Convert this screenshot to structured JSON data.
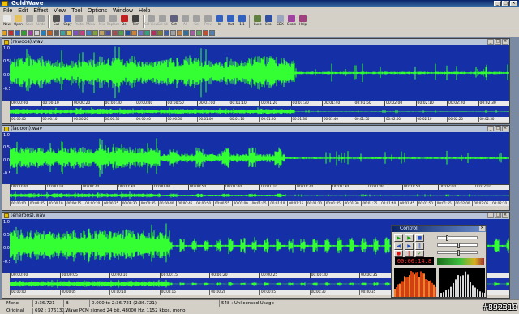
{
  "window": {
    "title": "GoldWave"
  },
  "menu": [
    "File",
    "Edit",
    "Effect",
    "View",
    "Tool",
    "Options",
    "Window",
    "Help"
  ],
  "toolbar": [
    {
      "label": "New",
      "icon": "new-doc-icon",
      "color": "#e8e8e8",
      "enabled": true
    },
    {
      "label": "Open",
      "icon": "open-folder-icon",
      "color": "#e5c060",
      "enabled": true
    },
    {
      "label": "Save",
      "icon": "save-icon",
      "color": "#a0a0a0",
      "enabled": false
    },
    {
      "label": "Undo",
      "icon": "undo-icon",
      "color": "#a0a0a0",
      "enabled": false
    },
    {
      "label": "Cut",
      "icon": "cut-icon",
      "color": "#505050",
      "enabled": true
    },
    {
      "label": "Copy",
      "icon": "copy-icon",
      "color": "#4060c0",
      "enabled": true
    },
    {
      "label": "Paste",
      "icon": "paste-icon",
      "color": "#a0a0a0",
      "enabled": false
    },
    {
      "label": "P.New",
      "icon": "paste-new-icon",
      "color": "#a0a0a0",
      "enabled": false
    },
    {
      "label": "Mix",
      "icon": "mix-icon",
      "color": "#a0a0a0",
      "enabled": false
    },
    {
      "label": "Replace",
      "icon": "replace-icon",
      "color": "#a0a0a0",
      "enabled": false
    },
    {
      "label": "Del",
      "icon": "delete-icon",
      "color": "#c02020",
      "enabled": true
    },
    {
      "label": "Trim",
      "icon": "trim-icon",
      "color": "#404040",
      "enabled": true
    },
    {
      "label": "Sel View",
      "icon": "select-view-icon",
      "color": "#a0a0a0",
      "enabled": false
    },
    {
      "label": "Sel All",
      "icon": "select-all-icon",
      "color": "#a0a0a0",
      "enabled": false
    },
    {
      "label": "Set",
      "icon": "set-icon",
      "color": "#606080",
      "enabled": true
    },
    {
      "label": "All",
      "icon": "all-icon",
      "color": "#a0a0a0",
      "enabled": false
    },
    {
      "label": "Sel",
      "icon": "sel-icon",
      "color": "#a0a0a0",
      "enabled": false
    },
    {
      "label": "Prev",
      "icon": "prev-icon",
      "color": "#a0a0a0",
      "enabled": false
    },
    {
      "label": "In",
      "icon": "zoom-in-icon",
      "color": "#3060c0",
      "enabled": true
    },
    {
      "label": "Out",
      "icon": "zoom-out-icon",
      "color": "#3060c0",
      "enabled": true
    },
    {
      "label": "1:1",
      "icon": "zoom-100-icon",
      "color": "#3060c0",
      "enabled": true
    },
    {
      "label": "Cues",
      "icon": "cues-icon",
      "color": "#608040",
      "enabled": true
    },
    {
      "label": "Eval",
      "icon": "eval-icon",
      "color": "#2f50a0",
      "enabled": true
    },
    {
      "label": "CDX",
      "icon": "cd-icon",
      "color": "#9aa6c0",
      "enabled": true
    },
    {
      "label": "Chain",
      "icon": "chain-icon",
      "color": "#a040a0",
      "enabled": true
    },
    {
      "label": "Help",
      "icon": "help-icon",
      "color": "#a04080",
      "enabled": true
    }
  ],
  "waves": [
    {
      "title": "(rewoos).wav",
      "scale": [
        "1.0",
        "0.5",
        "0.0",
        "-0.5"
      ],
      "ticks": [
        "00:00:00",
        "00:00:10",
        "00:00:20",
        "00:00:30",
        "00:00:40",
        "00:00:50",
        "00:01:00",
        "00:01:10",
        "00:01:20",
        "00:01:30",
        "00:01:40",
        "00:01:50",
        "00:02:00",
        "00:02:10",
        "00:02:20",
        "00:02:30"
      ],
      "overview_ticks": [
        "00:00:00",
        "00:00:10",
        "00:00:20",
        "00:00:30",
        "00:00:40",
        "00:00:50",
        "00:01:00",
        "00:01:10",
        "00:01:20",
        "00:01:30",
        "00:01:40",
        "00:01:50",
        "00:02:00",
        "00:02:10",
        "00:02:20",
        "00:02:30"
      ]
    },
    {
      "title": "(lagoon).wav",
      "scale": [
        "1.0",
        "0.5",
        "0.0",
        "-0.5"
      ],
      "ticks": [
        "00:00:00",
        "00:00:10",
        "00:00:20",
        "00:00:30",
        "00:00:40",
        "00:00:50",
        "00:01:00",
        "00:01:10",
        "00:01:20",
        "00:01:30",
        "00:01:40",
        "00:01:50",
        "00:02:00",
        "00:02:10"
      ],
      "overview_ticks": [
        "00:00:00",
        "00:00:05",
        "00:00:10",
        "00:00:15",
        "00:00:20",
        "00:00:25",
        "00:00:30",
        "00:00:35",
        "00:00:40",
        "00:00:45",
        "00:00:50",
        "00:00:55",
        "00:01:00",
        "00:01:05",
        "00:01:10",
        "00:01:15",
        "00:01:20",
        "00:01:25",
        "00:01:30",
        "00:01:35",
        "00:01:40",
        "00:01:45",
        "00:01:50",
        "00:01:55",
        "00:02:00",
        "00:02:05",
        "00:02:10"
      ]
    },
    {
      "title": "(eneroos).wav",
      "scale": [
        "1.0",
        "0.5",
        "0.0",
        "-0.5"
      ],
      "ticks": [
        "00:00:00",
        "00:00:05",
        "00:00:10",
        "00:00:15",
        "00:00:20",
        "00:00:25",
        "00:00:30",
        "00:00:35",
        "00:00:40",
        "00:00:45"
      ],
      "overview_ticks": [
        "00:00:00",
        "00:00:05",
        "00:00:10",
        "00:00:15",
        "00:00:20",
        "00:00:25",
        "00:00:30",
        "00:00:35",
        "00:00:40",
        "00:00:45"
      ]
    }
  ],
  "control": {
    "title": "Control",
    "time": "00:00:14.8",
    "buttons": [
      "play-icon",
      "play-selection-icon",
      "stop-icon",
      "rewind-icon",
      "fast-forward-icon",
      "pause-icon",
      "record-icon",
      "record-pause-icon",
      "options-icon"
    ]
  },
  "status": {
    "row1": {
      "mode": "Mono",
      "length": "2:36.721",
      "flag": "B",
      "range": "0.000 to 2:36.721 (2:36.721)",
      "usage": "548 : Unlicensed Usage"
    },
    "row2": {
      "state": "Original",
      "counts": "692 : 3761311",
      "format": "Wave PCM signed 24 bit, 48000 Hz, 1152 kbps, mono"
    }
  },
  "watermark": "#892310",
  "colors": {
    "wave_bg": "#1530a6",
    "wave_fg": "#33ff33",
    "titlebar": "#0a246a"
  }
}
